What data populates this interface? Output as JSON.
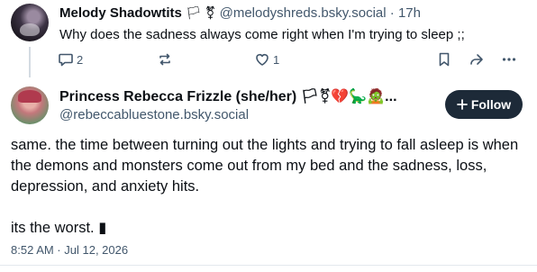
{
  "parent_post": {
    "author_name": "Melody Shadowtits",
    "author_flags": "🏳 ⚧",
    "handle": "@melodyshreds.bsky.social",
    "separator": "·",
    "time": "17h",
    "text": "Why does the sadness always come right when I'm trying to sleep ;;",
    "reply_count": "2",
    "repost_count": "",
    "like_count": "1"
  },
  "main_post": {
    "author_name": "Princess Rebecca Frizzle (she/her)",
    "author_emojis": "🏳⚧💔🦕🧟...",
    "handle": "@rebeccabluestone.bsky.social",
    "follow_label": "Follow",
    "paragraphs": [
      "same. the time between turning out the lights and trying to fall asleep is when the demons and monsters come out from my bed and the sadness, loss, depression, and anxiety hits.",
      "its the worst. ▮"
    ],
    "timestamp": "8:52 AM · Jul 12, 2026"
  },
  "colors": {
    "muted": "#42576c",
    "follow_bg": "#1d2a38",
    "thread_line": "#d4dbe2"
  }
}
